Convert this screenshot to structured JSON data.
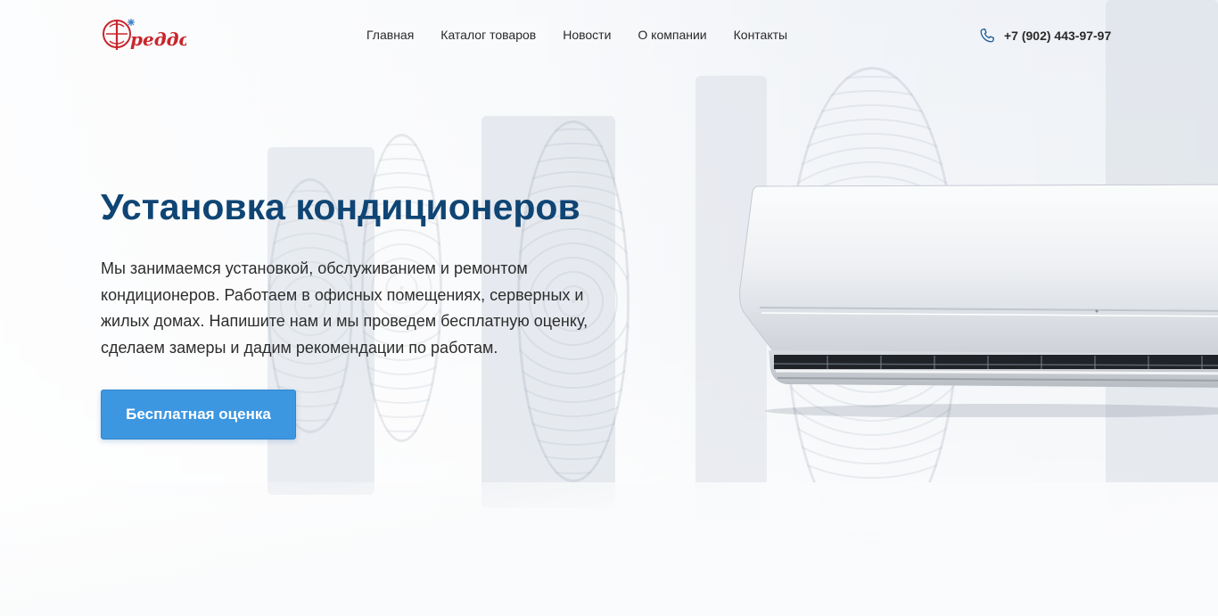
{
  "brand": {
    "name": "Фреддо",
    "color": "#c8262d"
  },
  "nav": {
    "items": [
      {
        "label": "Главная"
      },
      {
        "label": "Каталог товаров"
      },
      {
        "label": "Новости"
      },
      {
        "label": "О компании"
      },
      {
        "label": "Контакты"
      }
    ]
  },
  "contact": {
    "phone": "+7 (902) 443-97-97",
    "icon": "phone-icon"
  },
  "hero": {
    "title": "Установка кондиционеров",
    "description": "Мы занимаемся установкой, обслуживанием и ремонтом кондиционеров. Работаем в офисных помещениях, серверных и жилых домах. Напишите нам и мы проведем бесплатную оценку, сделаем замеры и дадим рекомендации по работам.",
    "cta_label": "Бесплатная оценка"
  },
  "colors": {
    "accent": "#3d97e0",
    "title": "#0f4574",
    "text": "#2d2d2d",
    "phone_icon": "#1f5f99"
  }
}
